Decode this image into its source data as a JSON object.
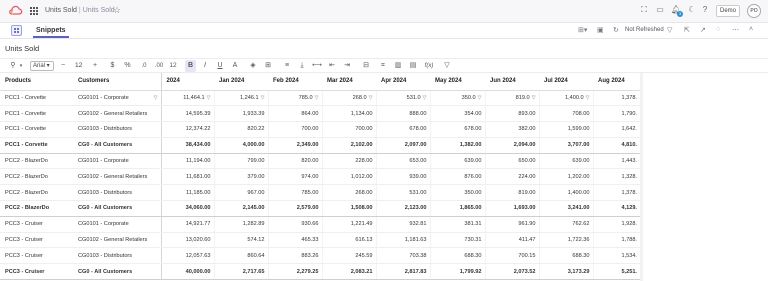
{
  "app": {
    "title": "Units Sold",
    "separator": "|",
    "subtitle": "Units Sold"
  },
  "topbar": {
    "notification_count": "3",
    "demo_label": "Demo",
    "avatar_initials": "PO"
  },
  "tabs": {
    "active_label": "Snippets",
    "refresh_status": "Not Refreshed"
  },
  "report": {
    "title": "Units Sold"
  },
  "format_toolbar": {
    "font_family": "Arial",
    "font_size": "12",
    "currency_symbol": "$",
    "percent_symbol": "%",
    "decimal_decrease": ".0",
    "decimal_increase": ".00",
    "number_format": "12",
    "bold": "B",
    "italic": "I",
    "underline": "U",
    "text_color": "A",
    "formula": "f(x)"
  },
  "table": {
    "columns": [
      "Products",
      "Customers",
      "2024",
      "Jan 2024",
      "Feb 2024",
      "Mar 2024",
      "Apr 2024",
      "May 2024",
      "Jun 2024",
      "Jul 2024",
      "Aug 2024"
    ],
    "rows": [
      {
        "product": "PCC1 - Corvette",
        "customer": "CG0101 - Corporate",
        "values": [
          "11,464.1",
          "1,246.1",
          "785.0",
          "268.0",
          "531.0",
          "350.0",
          "819.0",
          "1,400.0",
          "1,378."
        ],
        "total": false
      },
      {
        "product": "PCC1 - Corvette",
        "customer": "CG0102 - General Retailers",
        "values": [
          "14,595.39",
          "1,933.39",
          "864.00",
          "1,134.00",
          "888.00",
          "354.00",
          "893.00",
          "708.00",
          "1,790."
        ],
        "total": false
      },
      {
        "product": "PCC1 - Corvette",
        "customer": "CG0103 - Distributors",
        "values": [
          "12,374.22",
          "820.22",
          "700.00",
          "700.00",
          "678.00",
          "678.00",
          "382.00",
          "1,599.00",
          "1,642."
        ],
        "total": false
      },
      {
        "product": "PCC1 - Corvette",
        "customer": "CG0 - All Customers",
        "values": [
          "38,434.00",
          "4,000.00",
          "2,349.00",
          "2,102.00",
          "2,097.00",
          "1,382.00",
          "2,094.00",
          "3,707.00",
          "4,810."
        ],
        "total": true
      },
      {
        "product": "PCC2 - BlazerDo",
        "customer": "CG0101 - Corporate",
        "values": [
          "11,194.00",
          "799.00",
          "820.00",
          "228.00",
          "653.00",
          "639.00",
          "650.00",
          "639.00",
          "1,443."
        ],
        "total": false
      },
      {
        "product": "PCC2 - BlazerDo",
        "customer": "CG0102 - General Retailers",
        "values": [
          "11,681.00",
          "379.00",
          "974.00",
          "1,012.00",
          "939.00",
          "876.00",
          "224.00",
          "1,202.00",
          "1,328."
        ],
        "total": false
      },
      {
        "product": "PCC2 - BlazerDo",
        "customer": "CG0103 - Distributors",
        "values": [
          "11,185.00",
          "967.00",
          "785.00",
          "268.00",
          "531.00",
          "350.00",
          "819.00",
          "1,400.00",
          "1,378."
        ],
        "total": false
      },
      {
        "product": "PCC2 - BlazerDo",
        "customer": "CG0 - All Customers",
        "values": [
          "34,060.00",
          "2,145.00",
          "2,579.00",
          "1,508.00",
          "2,123.00",
          "1,865.00",
          "1,693.00",
          "3,241.00",
          "4,129."
        ],
        "total": true
      },
      {
        "product": "PCC3 - Cruiser",
        "customer": "CG0101 - Corporate",
        "values": [
          "14,921.77",
          "1,282.89",
          "930.66",
          "1,221.49",
          "932.81",
          "381.31",
          "961.90",
          "762.62",
          "1,928."
        ],
        "total": false
      },
      {
        "product": "PCC3 - Cruiser",
        "customer": "CG0102 - General Retailers",
        "values": [
          "13,020.60",
          "574.12",
          "465.33",
          "616.13",
          "1,181.63",
          "730.31",
          "411.47",
          "1,722.36",
          "1,788."
        ],
        "total": false
      },
      {
        "product": "PCC3 - Cruiser",
        "customer": "CG0103 - Distributors",
        "values": [
          "12,057.63",
          "860.64",
          "883.26",
          "245.59",
          "703.38",
          "688.30",
          "700.15",
          "688.30",
          "1,534."
        ],
        "total": false
      },
      {
        "product": "PCC3 - Cruiser",
        "customer": "CG0 - All Customers",
        "values": [
          "40,000.00",
          "2,717.65",
          "2,279.25",
          "2,083.21",
          "2,817.83",
          "1,799.92",
          "2,073.52",
          "3,173.29",
          "5,251."
        ],
        "total": true
      }
    ]
  },
  "colors": {
    "accent": "#5c61c0",
    "notification": "#2b8fd6",
    "header_bg": "#f7f7f9"
  }
}
